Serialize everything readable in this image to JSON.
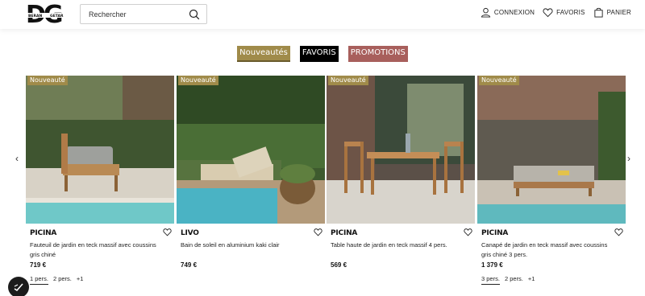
{
  "header": {
    "logo_text": "DG",
    "logo_left": "BERAN",
    "logo_right": "GETAR",
    "search_placeholder": "Rechercher",
    "actions": [
      {
        "label": "CONNEXION",
        "icon": "user-icon"
      },
      {
        "label": "FAVORIS",
        "icon": "heart-icon"
      },
      {
        "label": "PANIER",
        "icon": "bag-icon"
      }
    ]
  },
  "tabs": [
    {
      "label": "Nouveautés",
      "state": "active"
    },
    {
      "label": "FAVORIS",
      "state": "default"
    },
    {
      "label": "PROMOTIONS",
      "state": "default"
    }
  ],
  "colors": {
    "accent": "#a08b4a",
    "promo": "#a85f5c",
    "dark": "#000000"
  },
  "products": [
    {
      "badge": "Nouveauté",
      "brand": "PICINA",
      "description": "Fauteuil de jardin en teck massif avec coussins gris chiné",
      "price": "719 €",
      "sizes": [
        "1 pers.",
        "2 pers.",
        "+1"
      ],
      "selected_size": "1 pers."
    },
    {
      "badge": "Nouveauté",
      "brand": "LIVO",
      "description": "Bain de soleil en aluminium kaki clair",
      "price": "749 €",
      "sizes": [],
      "selected_size": ""
    },
    {
      "badge": "Nouveauté",
      "brand": "PICINA",
      "description": "Table haute de jardin en teck massif 4 pers.",
      "price": "569 €",
      "sizes": [],
      "selected_size": ""
    },
    {
      "badge": "Nouveauté",
      "brand": "PICINA",
      "description": "Canapé de jardin en teck massif avec coussins gris chiné 3 pers.",
      "price": "1 379 €",
      "sizes": [
        "3 pers.",
        "2 pers.",
        "+1"
      ],
      "selected_size": "3 pers."
    }
  ],
  "carousel": {
    "prev_icon": "chevron-left-icon",
    "next_icon": "chevron-right-icon"
  },
  "fab_icon": "accessibility-icon"
}
